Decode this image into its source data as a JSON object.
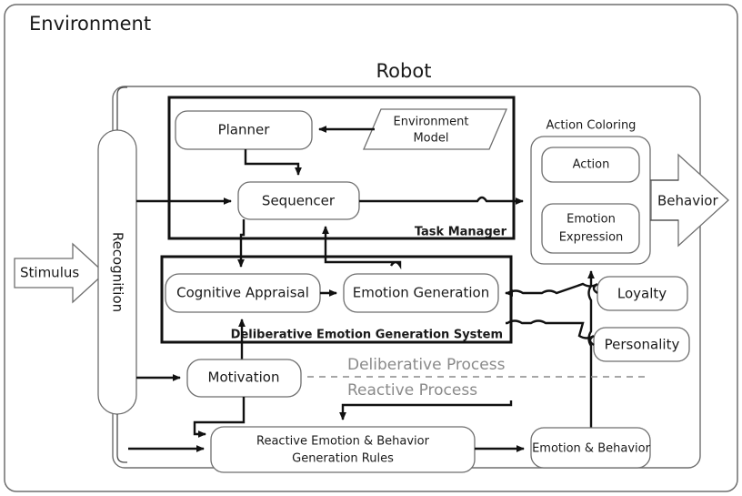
{
  "frame": {
    "environment_label": "Environment",
    "robot_label": "Robot"
  },
  "io": {
    "stimulus_label": "Stimulus",
    "behavior_label": "Behavior"
  },
  "recognition": {
    "label": "Recognition"
  },
  "task_manager": {
    "group_label": "Task Manager",
    "nodes": {
      "planner": "Planner",
      "sequencer": "Sequencer",
      "environment_model_line1": "Environment",
      "environment_model_line2": "Model"
    }
  },
  "deliberative_system": {
    "group_label": "Deliberative Emotion Generation System",
    "nodes": {
      "cognitive_appraisal": "Cognitive Appraisal",
      "emotion_generation": "Emotion Generation"
    }
  },
  "action_coloring": {
    "group_label": "Action Coloring",
    "nodes": {
      "action": "Action",
      "emotion_expression_line1": "Emotion",
      "emotion_expression_line2": "Expression"
    }
  },
  "modulators": {
    "loyalty": "Loyalty",
    "personality": "Personality"
  },
  "motivation": {
    "label": "Motivation"
  },
  "reactive": {
    "rules_line1": "Reactive Emotion & Behavior",
    "rules_line2": "Generation Rules",
    "emotion_behavior": "Emotion & Behavior"
  },
  "process_divider": {
    "upper_label": "Deliberative Process",
    "lower_label": "Reactive Process"
  },
  "colors": {
    "node_stroke": "#6e6e6e",
    "group_heavy_stroke": "#111111",
    "arrow": "#111111",
    "divider_gray": "#8a8a8a",
    "background": "#ffffff"
  }
}
